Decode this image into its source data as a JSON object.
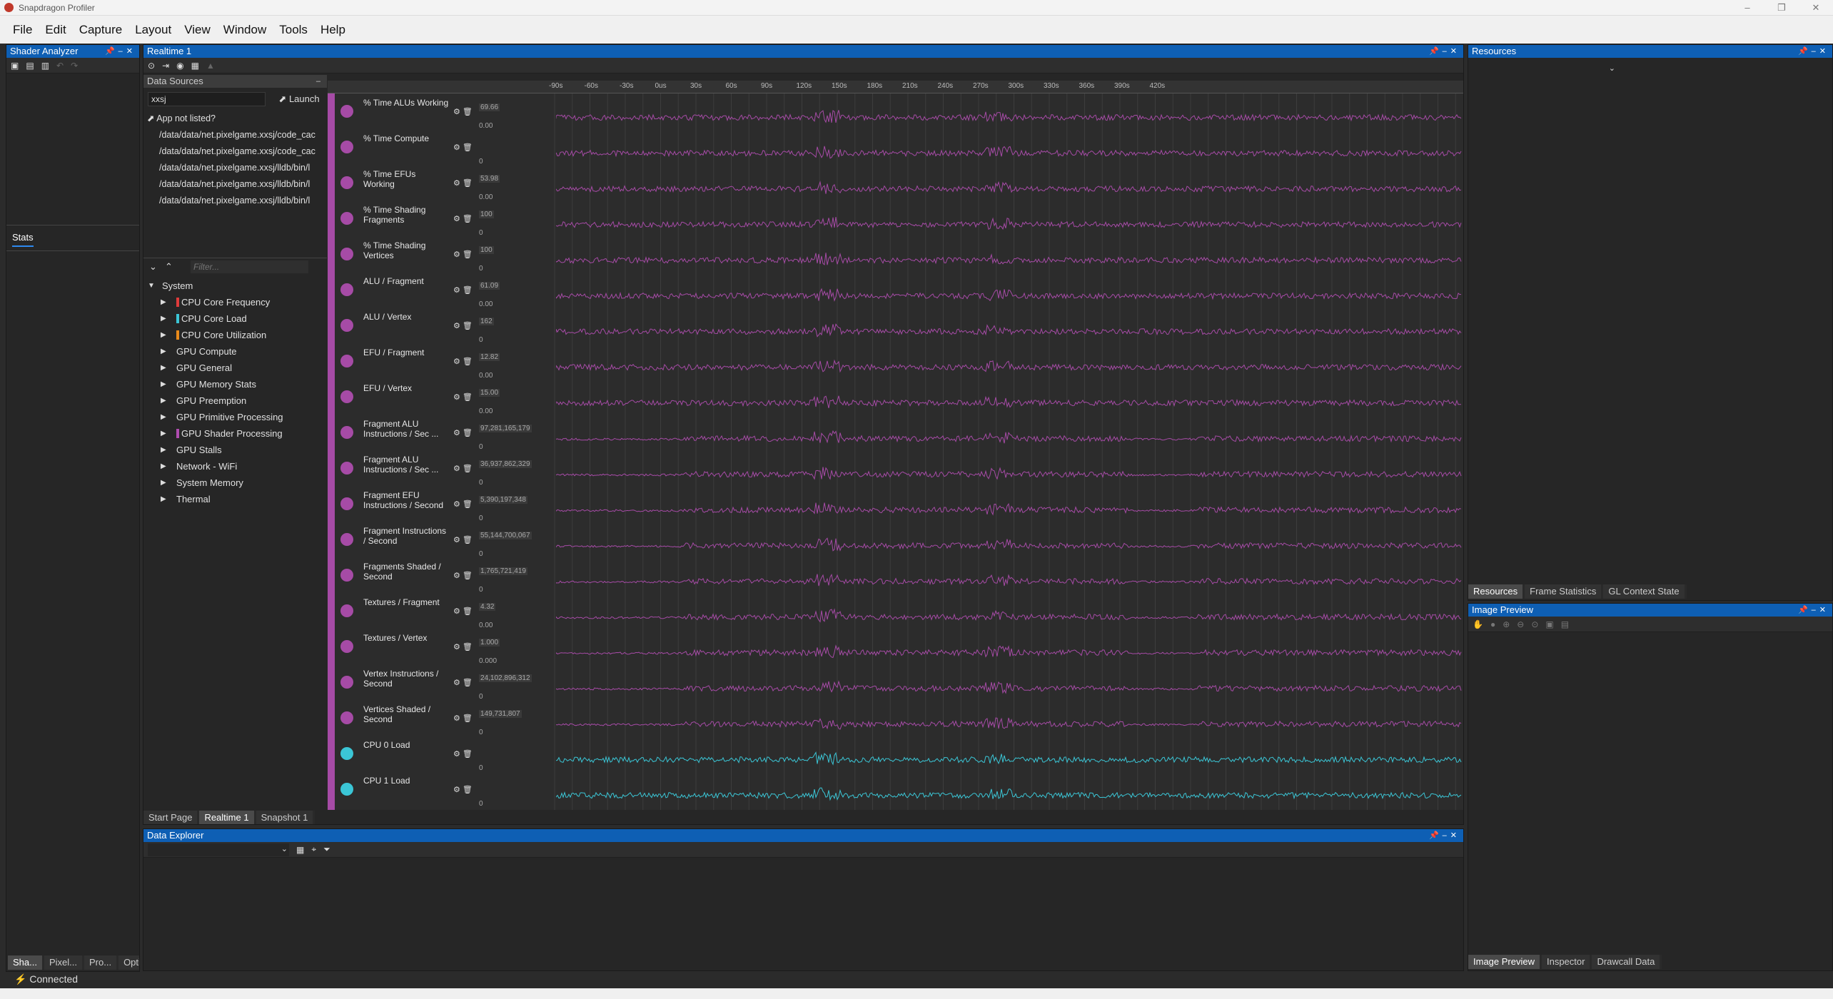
{
  "window": {
    "title": "Snapdragon Profiler",
    "controls": [
      "–",
      "❐",
      "✕"
    ]
  },
  "menu": [
    "File",
    "Edit",
    "Capture",
    "Layout",
    "View",
    "Window",
    "Tools",
    "Help"
  ],
  "shader_analyzer": {
    "title": "Shader Analyzer",
    "stats_tab": "Stats",
    "bottom_tabs": [
      "Sha...",
      "Pixel...",
      "Pro...",
      "Opti..."
    ]
  },
  "realtime": {
    "title": "Realtime 1"
  },
  "data_sources": {
    "title": "Data Sources",
    "search_value": "xxsj",
    "launch_label": "Launch",
    "not_listed": "App not listed?",
    "processes": [
      "/data/data/net.pixelgame.xxsj/code_cac",
      "/data/data/net.pixelgame.xxsj/code_cac",
      "/data/data/net.pixelgame.xxsj/lldb/bin/l",
      "/data/data/net.pixelgame.xxsj/lldb/bin/l",
      "/data/data/net.pixelgame.xxsj/lldb/bin/l"
    ]
  },
  "metrics": {
    "filter_placeholder": "Filter...",
    "root": "System",
    "items": [
      {
        "label": "CPU Core Frequency",
        "color": "#e03b3b"
      },
      {
        "label": "CPU Core Load",
        "color": "#3bc6d6"
      },
      {
        "label": "CPU Core Utilization",
        "color": "#e88a1a"
      },
      {
        "label": "GPU Compute",
        "color": ""
      },
      {
        "label": "GPU General",
        "color": ""
      },
      {
        "label": "GPU Memory Stats",
        "color": ""
      },
      {
        "label": "GPU Preemption",
        "color": ""
      },
      {
        "label": "GPU Primitive Processing",
        "color": ""
      },
      {
        "label": "GPU Shader Processing",
        "color": "#b04cb0"
      },
      {
        "label": "GPU Stalls",
        "color": ""
      },
      {
        "label": "Network - WiFi",
        "color": ""
      },
      {
        "label": "System Memory",
        "color": ""
      },
      {
        "label": "Thermal",
        "color": ""
      }
    ]
  },
  "timeline": {
    "ticks": [
      "-90s",
      "-60s",
      "-30s",
      "0us",
      "30s",
      "60s",
      "90s",
      "120s",
      "150s",
      "180s",
      "210s",
      "240s",
      "270s",
      "300s",
      "330s",
      "360s",
      "390s",
      "420s"
    ]
  },
  "tracks": [
    {
      "label": "% Time ALUs Working",
      "max": "69.66",
      "min": "0.00",
      "color": "#a64ba6"
    },
    {
      "label": "% Time Compute",
      "max": "",
      "min": "0",
      "color": "#a64ba6"
    },
    {
      "label": "% Time EFUs Working",
      "max": "53.98",
      "min": "0.00",
      "color": "#a64ba6"
    },
    {
      "label": "% Time Shading Fragments",
      "max": "100",
      "min": "0",
      "color": "#a64ba6"
    },
    {
      "label": "% Time Shading Vertices",
      "max": "100",
      "min": "0",
      "color": "#a64ba6"
    },
    {
      "label": "ALU / Fragment",
      "max": "61.09",
      "min": "0.00",
      "color": "#a64ba6"
    },
    {
      "label": "ALU / Vertex",
      "max": "162",
      "min": "0",
      "color": "#a64ba6"
    },
    {
      "label": "EFU / Fragment",
      "max": "12.82",
      "min": "0.00",
      "color": "#a64ba6"
    },
    {
      "label": "EFU / Vertex",
      "max": "15.00",
      "min": "0.00",
      "color": "#a64ba6"
    },
    {
      "label": "Fragment ALU Instructions / Sec ...",
      "max": "97,281,165,179",
      "min": "0",
      "color": "#a64ba6"
    },
    {
      "label": "Fragment ALU Instructions / Sec ...",
      "max": "36,937,862,329",
      "min": "0",
      "color": "#a64ba6"
    },
    {
      "label": "Fragment EFU Instructions / Second",
      "max": "5,390,197,348",
      "min": "0",
      "color": "#a64ba6"
    },
    {
      "label": "Fragment Instructions / Second",
      "max": "55,144,700,067",
      "min": "0",
      "color": "#a64ba6"
    },
    {
      "label": "Fragments Shaded / Second",
      "max": "1,765,721,419",
      "min": "0",
      "color": "#a64ba6"
    },
    {
      "label": "Textures / Fragment",
      "max": "4.32",
      "min": "0.00",
      "color": "#a64ba6"
    },
    {
      "label": "Textures / Vertex",
      "max": "1.000",
      "min": "0.000",
      "color": "#a64ba6"
    },
    {
      "label": "Vertex Instructions / Second",
      "max": "24,102,896,312",
      "min": "0",
      "color": "#a64ba6"
    },
    {
      "label": "Vertices Shaded / Second",
      "max": "149,731,807",
      "min": "0",
      "color": "#a64ba6"
    },
    {
      "label": "CPU 0 Load",
      "max": "",
      "min": "0",
      "color": "#3bc6d6"
    },
    {
      "label": "CPU 1 Load",
      "max": "",
      "min": "0",
      "color": "#3bc6d6"
    }
  ],
  "center_tabs": [
    "Start Page",
    "Realtime 1",
    "Snapshot 1"
  ],
  "data_explorer": {
    "title": "Data Explorer"
  },
  "resources": {
    "title": "Resources",
    "tabs": [
      "Resources",
      "Frame Statistics",
      "GL Context State"
    ]
  },
  "image_preview": {
    "title": "Image Preview",
    "tabs": [
      "Image Preview",
      "Inspector",
      "Drawcall Data"
    ]
  },
  "status": {
    "text": "Connected"
  }
}
